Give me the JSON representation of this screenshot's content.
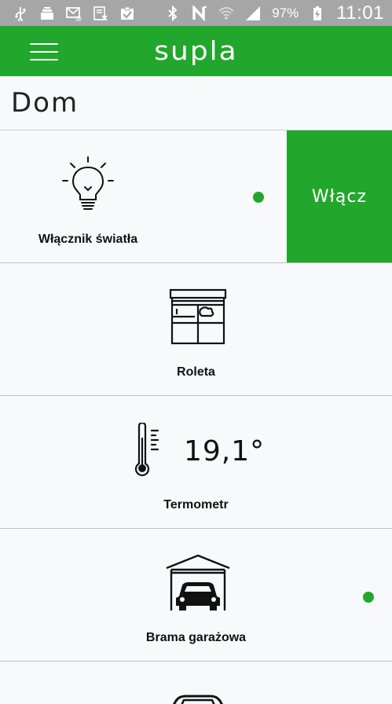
{
  "status_bar": {
    "icons_left": [
      "usb-icon",
      "stack-icon",
      "mail-icon",
      "sms-icon",
      "clipboard-check-icon"
    ],
    "icons_right": [
      "bluetooth-icon",
      "nfc-icon",
      "wifi-icon",
      "signal-icon",
      "battery-charging-icon"
    ],
    "battery": "97%",
    "time": "11:01"
  },
  "app_bar": {
    "title": "supla",
    "color": "#21a72c"
  },
  "location": {
    "title": "Dom"
  },
  "channels": [
    {
      "label": "Włącznik światła",
      "icon": "light-bulb-icon",
      "action_label": "Włącz",
      "status": "online"
    },
    {
      "label": "Roleta",
      "icon": "roller-shutter-icon",
      "status": "online"
    },
    {
      "label": "Termometr",
      "icon": "thermometer-icon",
      "value": "19,1°"
    },
    {
      "label": "Brama garażowa",
      "icon": "garage-icon",
      "status": "online"
    },
    {
      "label": "",
      "icon": "car-icon"
    }
  ]
}
